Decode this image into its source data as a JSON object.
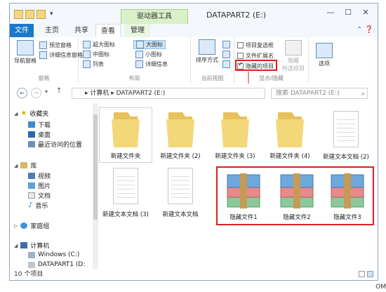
{
  "window": {
    "title": "DATAPART2 (E:)",
    "context_tab": "驱动器工具"
  },
  "tabs": [
    "文件",
    "主页",
    "共享",
    "查看",
    "管理"
  ],
  "ribbon": {
    "pane": {
      "nav_pane": "导航窗格",
      "preview": "预览窗格",
      "details": "详细信息窗格",
      "group": "窗格"
    },
    "layout": {
      "xl_icons": "超大图标",
      "large_icons": "大图标",
      "medium_icons": "中图标",
      "small_icons": "小图标",
      "list": "列表",
      "details": "详细信息",
      "group": "布局"
    },
    "current_view": {
      "sort": "排序方式",
      "group": "当前视图"
    },
    "show_hide": {
      "item_checkboxes": "项目复选框",
      "file_extensions": "文件扩展名",
      "hidden_items": "隐藏的项目",
      "hide_selected": "隐藏",
      "selected_items": "所选项目",
      "group": "显示/隐藏"
    },
    "options": "选项"
  },
  "address": {
    "path_computer": "计算机",
    "path_drive": "DATAPART2 (E:)",
    "search_placeholder": "搜索 DATAPART2 (E:)"
  },
  "nav": {
    "favorites": "收藏夹",
    "downloads": "下载",
    "desktop": "桌面",
    "recent": "最近访问的位置",
    "libraries": "库",
    "videos": "视频",
    "pictures": "图片",
    "documents": "文档",
    "music": "音乐",
    "homegroup": "家庭组",
    "computer": "计算机",
    "drive_c": "Windows (C:)",
    "drive_d": "DATAPART1 (D:"
  },
  "files": [
    {
      "name": "新建文件夹",
      "type": "folder",
      "selected": true
    },
    {
      "name": "新建文件夹 (2)",
      "type": "folder"
    },
    {
      "name": "新建文件夹 (3)",
      "type": "folder"
    },
    {
      "name": "新建文件夹 (4)",
      "type": "folder"
    },
    {
      "name": "新建文本文档 (2)",
      "type": "text"
    },
    {
      "name": "新建文本文档 (3)",
      "type": "text"
    },
    {
      "name": "新建文本文档",
      "type": "text"
    },
    {
      "name": "隐藏文件1",
      "type": "archive"
    },
    {
      "name": "隐藏文件2",
      "type": "archive"
    },
    {
      "name": "隐藏文件3",
      "type": "archive"
    }
  ],
  "status": {
    "item_count": "10 个项目"
  },
  "watermark": "OM",
  "colors": {
    "file_tab": "#1979ca",
    "highlight_red": "#e02020",
    "folder": "#f3d87a",
    "context_tab": "#d9f0c9"
  }
}
